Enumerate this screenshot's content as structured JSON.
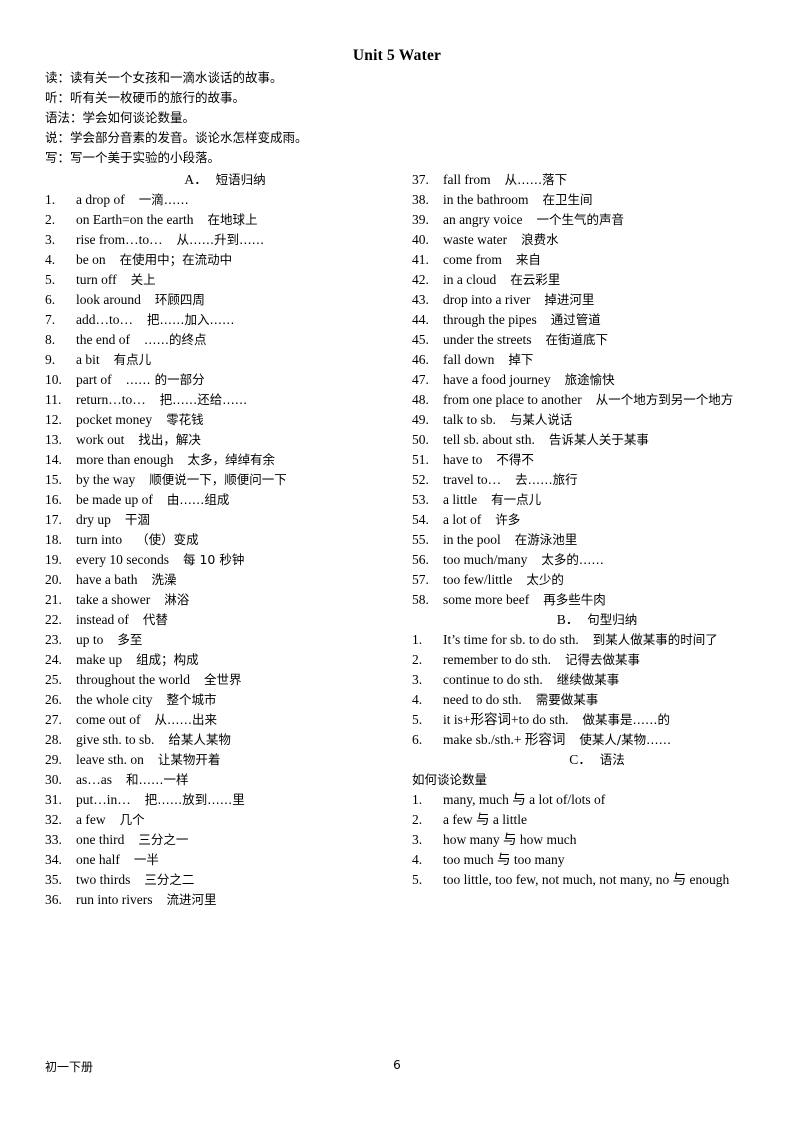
{
  "document": {
    "title": "Unit 5 Water",
    "intro_lines": [
      "读：读有关一个女孩和一滴水谈话的故事。",
      "听：听有关一枚硬币的旅行的故事。",
      "语法：学会如何谈论数量。",
      "说：学会部分音素的发音。谈论水怎样变成雨。",
      "写：写一个美于实验的小段落。"
    ],
    "footer": {
      "left_label": "初一下册",
      "page_number": "6"
    }
  },
  "sections": {
    "phrases": {
      "heading_letter": "A．",
      "heading_title": "短语归纳"
    },
    "sentences": {
      "heading_letter": "B．",
      "heading_title": "句型归纳"
    },
    "grammar": {
      "heading_letter": "C．",
      "heading_title": "语法",
      "subtitle": "如何谈论数量"
    }
  },
  "phrases_left": [
    {
      "n": "1.",
      "en": "a drop of",
      "zh": "一滴……"
    },
    {
      "n": "2.",
      "en": "on Earth=on the earth",
      "zh": "在地球上"
    },
    {
      "n": "3.",
      "en": "rise from…to…",
      "zh": "从……升到……"
    },
    {
      "n": "4.",
      "en": "be on",
      "zh": "在使用中；在流动中"
    },
    {
      "n": "5.",
      "en": "turn off",
      "zh": "关上"
    },
    {
      "n": "6.",
      "en": "look around",
      "zh": "环顾四周"
    },
    {
      "n": "7.",
      "en": "add…to…",
      "zh": "把……加入……"
    },
    {
      "n": "8.",
      "en": "the end of",
      "zh": "……的终点"
    },
    {
      "n": "9.",
      "en": "a bit",
      "zh": "有点儿"
    },
    {
      "n": "10.",
      "en": "part of",
      "zh": "…… 的一部分"
    },
    {
      "n": "11.",
      "en": "return…to…",
      "zh": "把……还给……"
    },
    {
      "n": "12.",
      "en": "pocket money",
      "zh": "零花钱"
    },
    {
      "n": "13.",
      "en": "work out",
      "zh": "找出，解决"
    },
    {
      "n": "14.",
      "en": "more than enough",
      "zh": "太多，绰绰有余"
    },
    {
      "n": "15.",
      "en": "by the way",
      "zh": "顺便说一下，顺便问一下"
    },
    {
      "n": "16.",
      "en": "be made up of",
      "zh": "由……组成"
    },
    {
      "n": "17.",
      "en": "dry up",
      "zh": "干涸"
    },
    {
      "n": "18.",
      "en": "turn into",
      "zh": "（使）变成"
    },
    {
      "n": "19.",
      "en": "every 10 seconds",
      "zh": "每 10 秒钟"
    },
    {
      "n": "20.",
      "en": "have a bath",
      "zh": "洗澡"
    },
    {
      "n": "21.",
      "en": "take a shower",
      "zh": "淋浴"
    },
    {
      "n": "22.",
      "en": "instead of",
      "zh": "代替"
    },
    {
      "n": "23.",
      "en": "up to",
      "zh": "多至"
    },
    {
      "n": "24.",
      "en": "make up",
      "zh": "组成；构成"
    },
    {
      "n": "25.",
      "en": "throughout the world",
      "zh": "全世界"
    },
    {
      "n": "26.",
      "en": "the whole city",
      "zh": "整个城市"
    },
    {
      "n": "27.",
      "en": "come out of",
      "zh": "从……出来"
    },
    {
      "n": "28.",
      "en": "give sth. to sb.",
      "zh": "给某人某物"
    },
    {
      "n": "29.",
      "en": "leave sth. on",
      "zh": "让某物开着"
    },
    {
      "n": "30.",
      "en": "as…as",
      "zh": "和……一样"
    },
    {
      "n": "31.",
      "en": "put…in…",
      "zh": "把……放到……里"
    },
    {
      "n": "32.",
      "en": "a few",
      "zh": "几个"
    },
    {
      "n": "33.",
      "en": "one third",
      "zh": "三分之一"
    },
    {
      "n": "34.",
      "en": "one half",
      "zh": "一半"
    },
    {
      "n": "35.",
      "en": "two thirds",
      "zh": "三分之二"
    },
    {
      "n": "36.",
      "en": "run into rivers",
      "zh": "流进河里"
    }
  ],
  "phrases_right": [
    {
      "n": "37.",
      "en": "fall from",
      "zh": "从……落下"
    },
    {
      "n": "38.",
      "en": "in the bathroom",
      "zh": "在卫生间"
    },
    {
      "n": "39.",
      "en": "an angry voice",
      "zh": "一个生气的声音"
    },
    {
      "n": "40.",
      "en": "waste water",
      "zh": "浪费水"
    },
    {
      "n": "41.",
      "en": "come from",
      "zh": "来自"
    },
    {
      "n": "42.",
      "en": "in a cloud",
      "zh": "在云彩里"
    },
    {
      "n": "43.",
      "en": "drop into a river",
      "zh": "掉进河里"
    },
    {
      "n": "44.",
      "en": "through the pipes",
      "zh": "通过管道"
    },
    {
      "n": "45.",
      "en": "under the streets",
      "zh": "在街道底下"
    },
    {
      "n": "46.",
      "en": "fall down",
      "zh": "掉下"
    },
    {
      "n": "47.",
      "en": "have a food journey",
      "zh": "旅途愉快"
    },
    {
      "n": "48.",
      "en": "from one place to another",
      "zh": "从一个地方到另一个地方"
    },
    {
      "n": "49.",
      "en": "talk to sb.",
      "zh": "与某人说话"
    },
    {
      "n": "50.",
      "en": "tell sb. about sth.",
      "zh": "告诉某人关于某事"
    },
    {
      "n": "51.",
      "en": "have to",
      "zh": "不得不"
    },
    {
      "n": "52.",
      "en": "travel to…",
      "zh": "去……旅行"
    },
    {
      "n": "53.",
      "en": "a little",
      "zh": "有一点儿"
    },
    {
      "n": "54.",
      "en": "a lot of",
      "zh": "许多"
    },
    {
      "n": "55.",
      "en": "in the pool",
      "zh": "在游泳池里"
    },
    {
      "n": "56.",
      "en": "too much/many",
      "zh": "太多的……"
    },
    {
      "n": "57.",
      "en": "too few/little",
      "zh": "太少的"
    },
    {
      "n": "58.",
      "en": "some more beef",
      "zh": "再多些牛肉"
    }
  ],
  "sentence_patterns": [
    {
      "n": "1.",
      "en": "It’s time for sb. to do sth.",
      "zh": "到某人做某事的时间了"
    },
    {
      "n": "2.",
      "en": "remember to do sth.",
      "zh": "记得去做某事"
    },
    {
      "n": "3.",
      "en": "continue to do sth.",
      "zh": "继续做某事"
    },
    {
      "n": "4.",
      "en": "need to do sth.",
      "zh": "需要做某事"
    },
    {
      "n": "5.",
      "en": "it is+形容词+to do sth.",
      "zh": "做某事是……的"
    },
    {
      "n": "6.",
      "en": "make sb./sth.+ 形容词",
      "zh": "使某人/某物……"
    }
  ],
  "grammar_points": [
    {
      "n": "1.",
      "en": "many, much 与 a lot of/lots of",
      "zh": ""
    },
    {
      "n": "2.",
      "en": "a few 与 a little",
      "zh": ""
    },
    {
      "n": "3.",
      "en": "how many 与 how much",
      "zh": ""
    },
    {
      "n": "4.",
      "en": "too much 与 too many",
      "zh": ""
    },
    {
      "n": "5.",
      "en": "too little, too few, not much, not many, no 与 enough",
      "zh": ""
    }
  ]
}
